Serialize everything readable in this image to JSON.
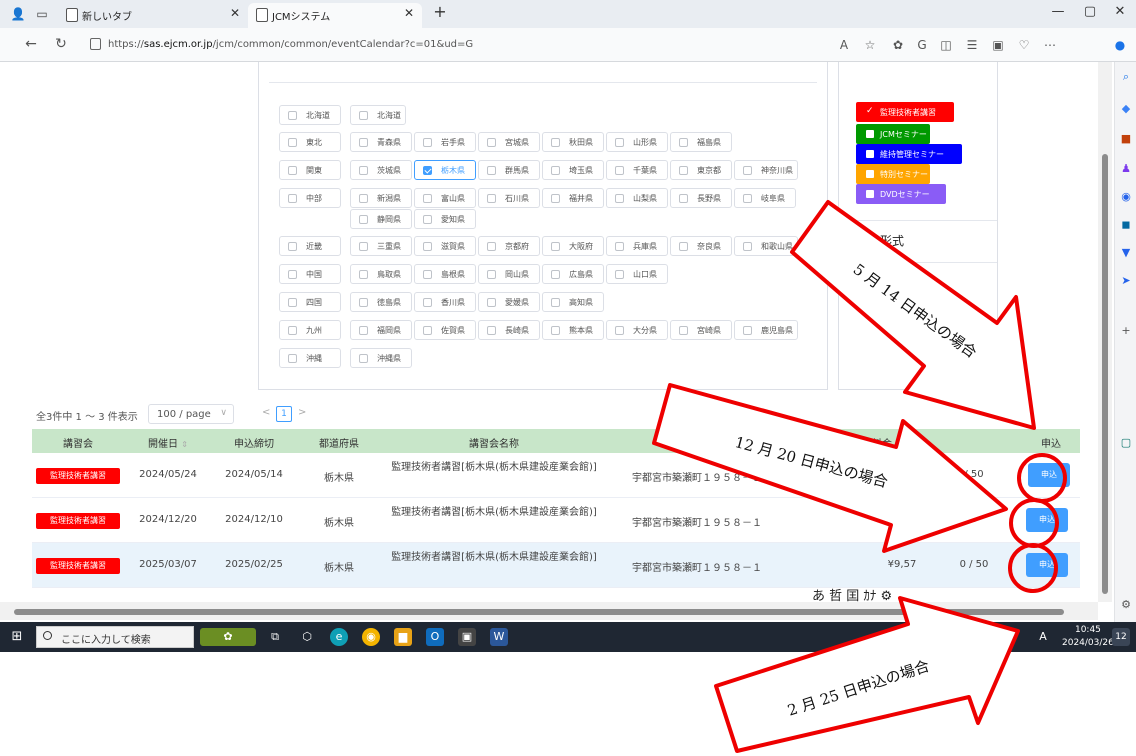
{
  "browser": {
    "tabs": [
      {
        "title": "新しいタブ",
        "active": false
      },
      {
        "title": "JCMシステム",
        "active": true
      }
    ],
    "new_tab": "+",
    "url_prefix": "https://",
    "url_host": "sas.ejcm.or.jp",
    "url_path": "/jcm/common/common/eventCalendar?c=01&ud=G",
    "win_min": "—",
    "win_max": "▢",
    "win_close": "✕"
  },
  "prefectures": {
    "regions": [
      {
        "name": "北海道",
        "prefs": [
          "北海道"
        ]
      },
      {
        "name": "東北",
        "prefs": [
          "青森県",
          "岩手県",
          "宮城県",
          "秋田県",
          "山形県",
          "福島県"
        ]
      },
      {
        "name": "関東",
        "prefs": [
          "茨城県",
          "栃木県",
          "群馬県",
          "埼玉県",
          "千葉県",
          "東京都",
          "神奈川県"
        ]
      },
      {
        "name": "中部",
        "prefs": [
          "新潟県",
          "富山県",
          "石川県",
          "福井県",
          "山梨県",
          "長野県",
          "岐阜県",
          "静岡県",
          "愛知県"
        ]
      },
      {
        "name": "近畿",
        "prefs": [
          "三重県",
          "滋賀県",
          "京都府",
          "大阪府",
          "兵庫県",
          "奈良県",
          "和歌山県"
        ]
      },
      {
        "name": "中国",
        "prefs": [
          "鳥取県",
          "島根県",
          "岡山県",
          "広島県",
          "山口県"
        ]
      },
      {
        "name": "四国",
        "prefs": [
          "徳島県",
          "香川県",
          "愛媛県",
          "高知県"
        ]
      },
      {
        "name": "九州",
        "prefs": [
          "福岡県",
          "佐賀県",
          "長崎県",
          "熊本県",
          "大分県",
          "宮崎県",
          "鹿児島県"
        ]
      },
      {
        "name": "沖縄",
        "prefs": [
          "沖縄県"
        ]
      }
    ],
    "checked": "栃木県"
  },
  "legend": {
    "items": [
      {
        "label": "監理技術者講習",
        "color": "#ff0000",
        "checked": true
      },
      {
        "label": "JCMセミナー",
        "color": "#009900",
        "checked": false
      },
      {
        "label": "維持管理セミナー",
        "color": "#0000ff",
        "checked": false
      },
      {
        "label": "特別セミナー",
        "color": "#ffa500",
        "checked": false
      },
      {
        "label": "DVDセミナー",
        "color": "#8a5cf6",
        "checked": false
      }
    ],
    "display_title": "示形式"
  },
  "pager": {
    "total": "全3件中 1 ～ 3 件表示",
    "page_size": "100 / page",
    "current_page": "1",
    "prev": "<",
    "next": ">"
  },
  "table": {
    "headers": {
      "kind": "講習会",
      "date": "開催日",
      "deadline": "申込締切",
      "pref": "都道府県",
      "name": "講習会名称",
      "fee": "料金",
      "apply": "申込"
    },
    "rows": [
      {
        "badge": "監理技術者講習",
        "date": "2024/05/24",
        "deadline": "2024/05/14",
        "pref": "栃木県",
        "name": "監理技術者講習[栃木県(栃木県建設産業会館)]",
        "address": "宇都宮市築瀬町１９５８－１",
        "fee": "",
        "seats": "/ 50",
        "button": "申込"
      },
      {
        "badge": "監理技術者講習",
        "date": "2024/12/20",
        "deadline": "2024/12/10",
        "pref": "栃木県",
        "name": "監理技術者講習[栃木県(栃木県建設産業会館)]",
        "address": "宇都宮市築瀬町１９５８－１",
        "fee": "¥9,5",
        "seats": "0",
        "button": "申込"
      },
      {
        "badge": "監理技術者講習",
        "date": "2025/03/07",
        "deadline": "2025/02/25",
        "pref": "栃木県",
        "name": "監理技術者講習[栃木県(栃木県建設産業会館)]",
        "address": "宇都宮市築瀬町１９５８－１",
        "fee": "¥9,57",
        "seats": "0 / 50",
        "button": "申込"
      }
    ]
  },
  "ime": {
    "text": "あ 哲 囯 ｶﾅ ⚙"
  },
  "taskbar": {
    "search_placeholder": "ここに入力して検索",
    "time": "10:45",
    "date": "2024/03/26",
    "ime_mode": "A",
    "notifications": "12"
  },
  "annotations": [
    {
      "text": "5 月 14 日申込の場合"
    },
    {
      "text": "12 月 20 日申込の場合"
    },
    {
      "text": "2 月 25 日申込の場合"
    }
  ],
  "colors": {
    "accent": "#409eff",
    "annotation": "#ff0000",
    "header_bg": "#c8e6c9"
  }
}
